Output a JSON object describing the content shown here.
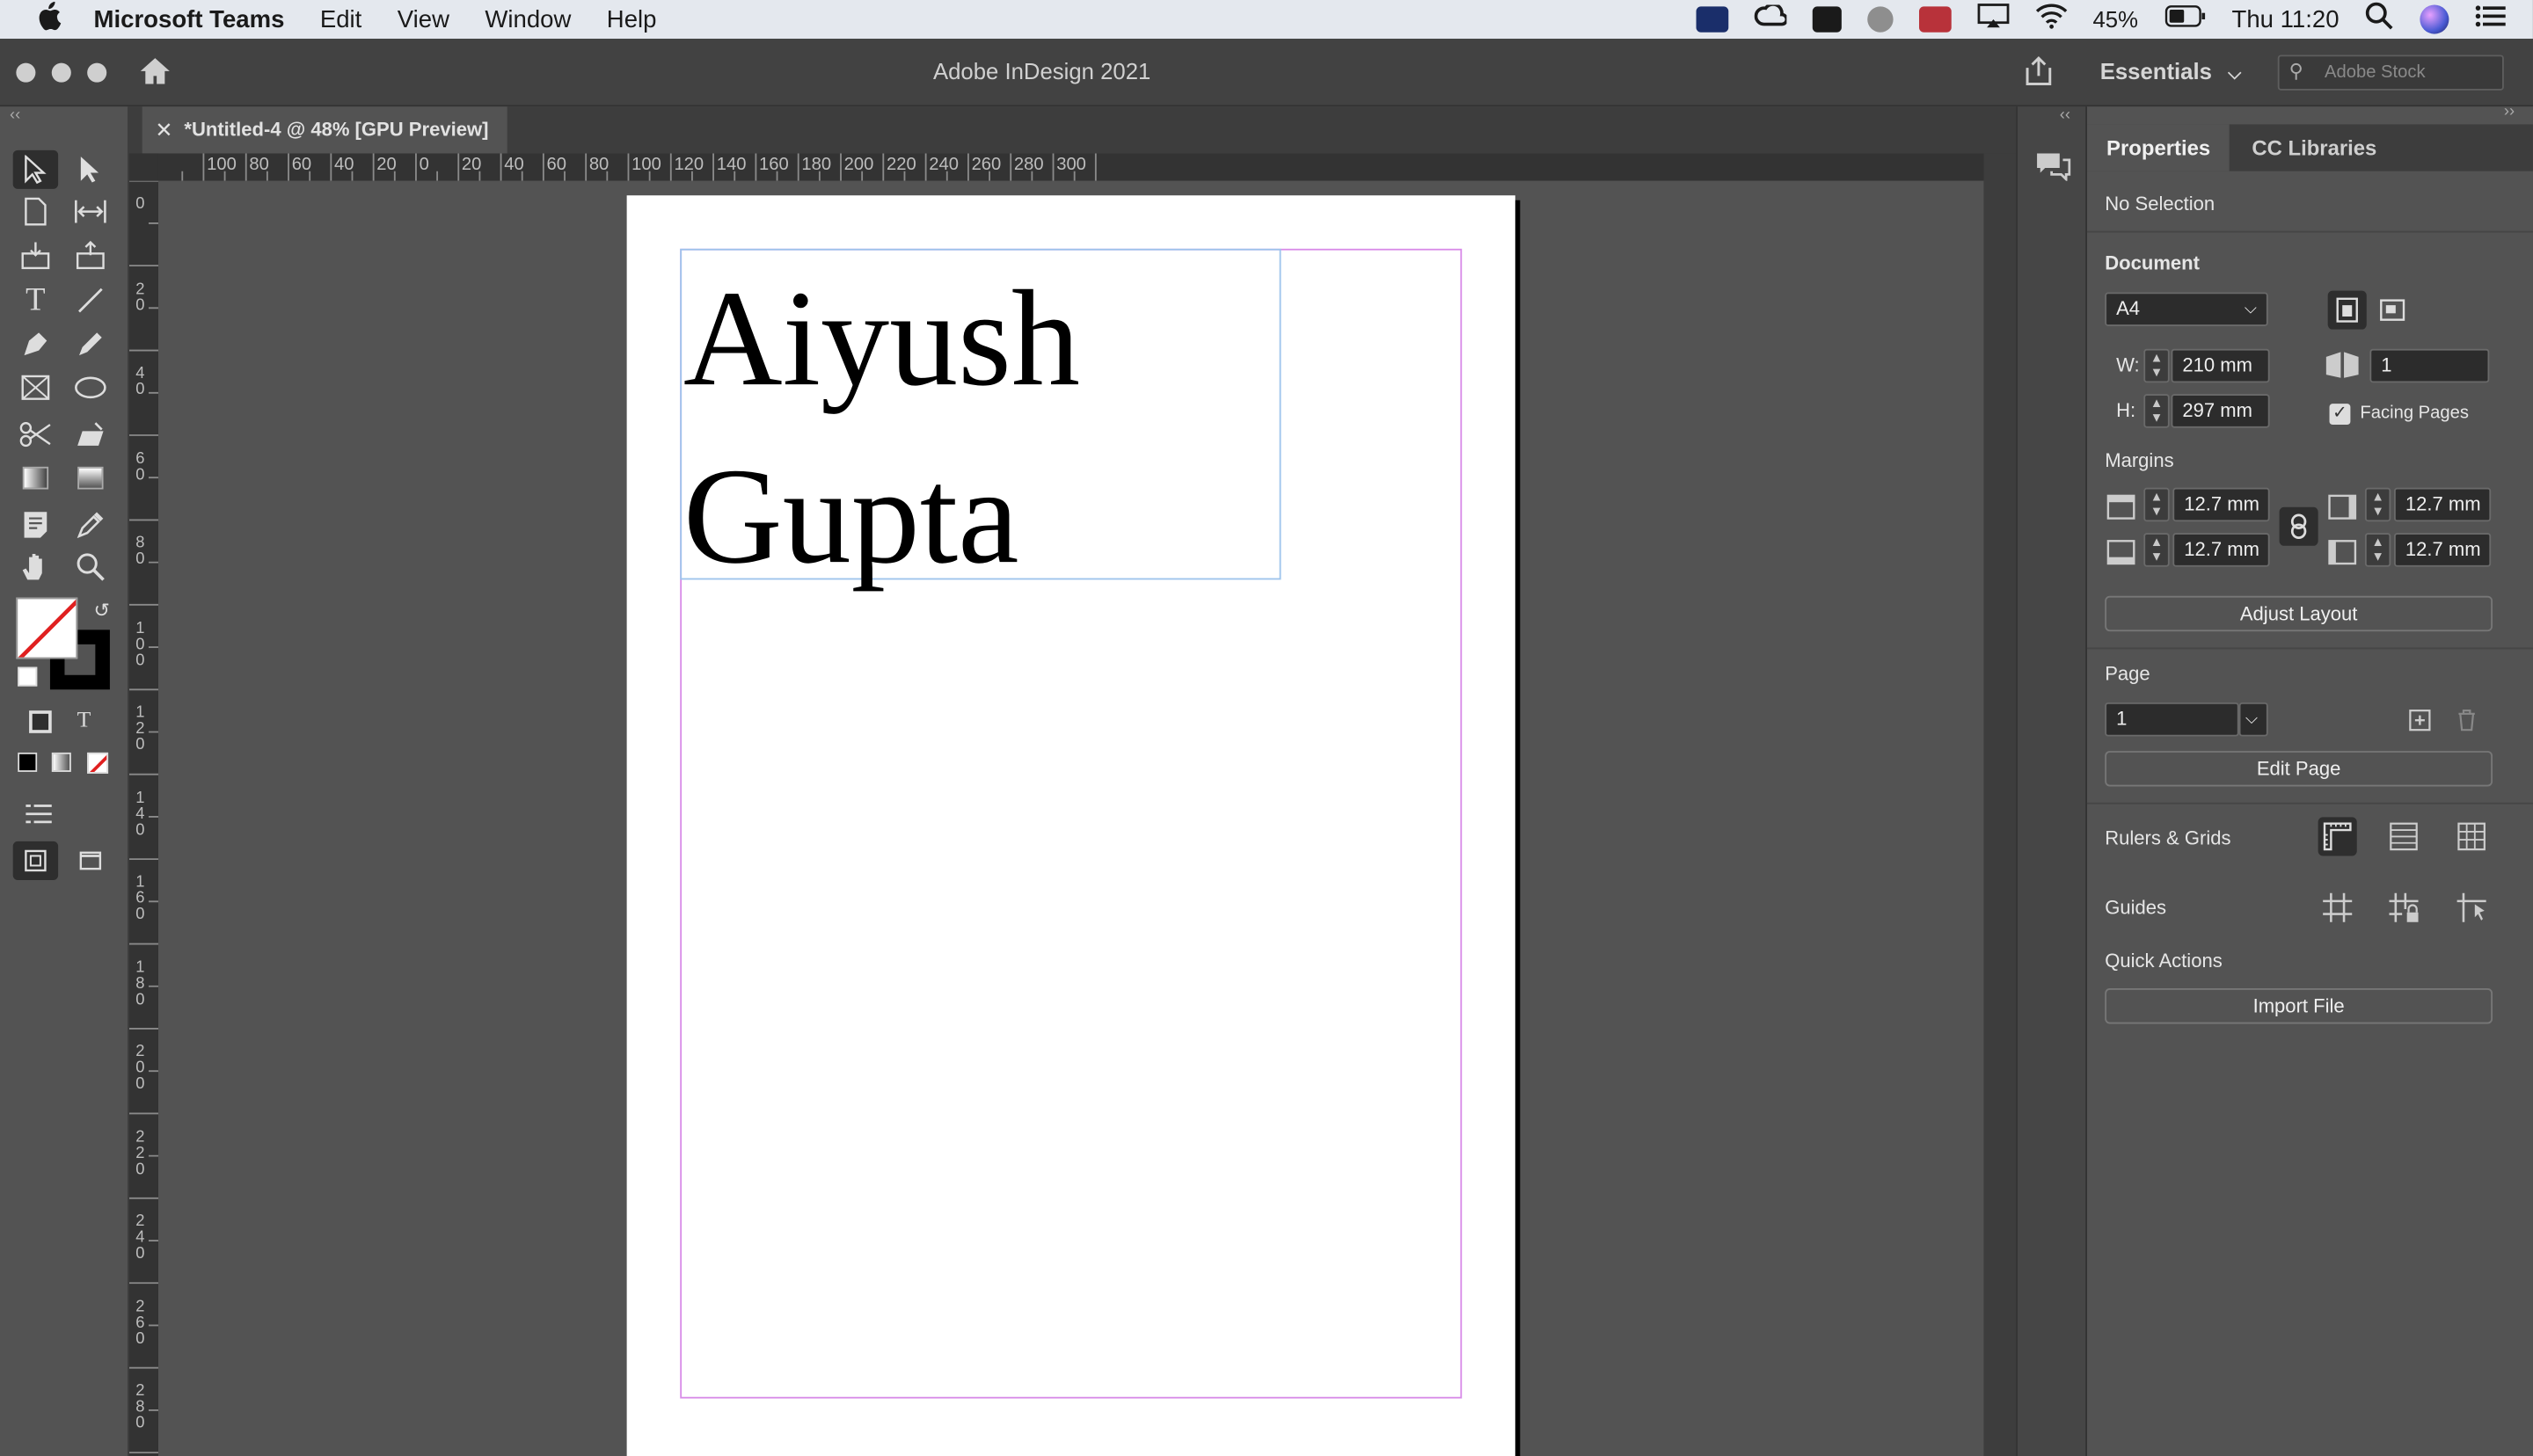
{
  "menubar": {
    "app_name": "Microsoft Teams",
    "items": [
      "Edit",
      "View",
      "Window",
      "Help"
    ],
    "battery": "45%",
    "clock": "Thu 11:20"
  },
  "titlebar": {
    "title": "Adobe InDesign 2021",
    "workspace": "Essentials",
    "stock_placeholder": "Adobe Stock"
  },
  "document": {
    "tab_label": "*Untitled-4 @ 48% [GPU Preview]",
    "text_line1": "Aiyush",
    "text_line2": "Gupta"
  },
  "rulers": {
    "horizontal": [
      "100",
      "80",
      "60",
      "40",
      "20",
      "0",
      "20",
      "40",
      "60",
      "80",
      "100",
      "120",
      "140",
      "160",
      "180",
      "200",
      "220",
      "240",
      "260",
      "280",
      "300"
    ],
    "vertical": [
      "0",
      "20",
      "40",
      "60",
      "80",
      "100",
      "120",
      "140",
      "160",
      "180",
      "200",
      "220",
      "240",
      "260",
      "280"
    ]
  },
  "properties": {
    "tabs": [
      "Properties",
      "CC Libraries"
    ],
    "selection": "No Selection",
    "document_label": "Document",
    "page_size": "A4",
    "w_label": "W:",
    "h_label": "H:",
    "width": "210 mm",
    "height": "297 mm",
    "pages": "1",
    "facing_pages": "Facing Pages",
    "margins_label": "Margins",
    "margin_top": "12.7 mm",
    "margin_bottom": "12.7 mm",
    "margin_inside": "12.7 mm",
    "margin_outside": "12.7 mm",
    "adjust_layout": "Adjust Layout",
    "page_label": "Page",
    "page_value": "1",
    "edit_page": "Edit Page",
    "rulers_grids": "Rulers & Grids",
    "guides": "Guides",
    "quick_actions": "Quick Actions",
    "import_file": "Import File"
  },
  "colors": {
    "margin_guide": "#d88be8",
    "frame_edge": "#9ec4ec",
    "panel_bg": "#535353"
  }
}
